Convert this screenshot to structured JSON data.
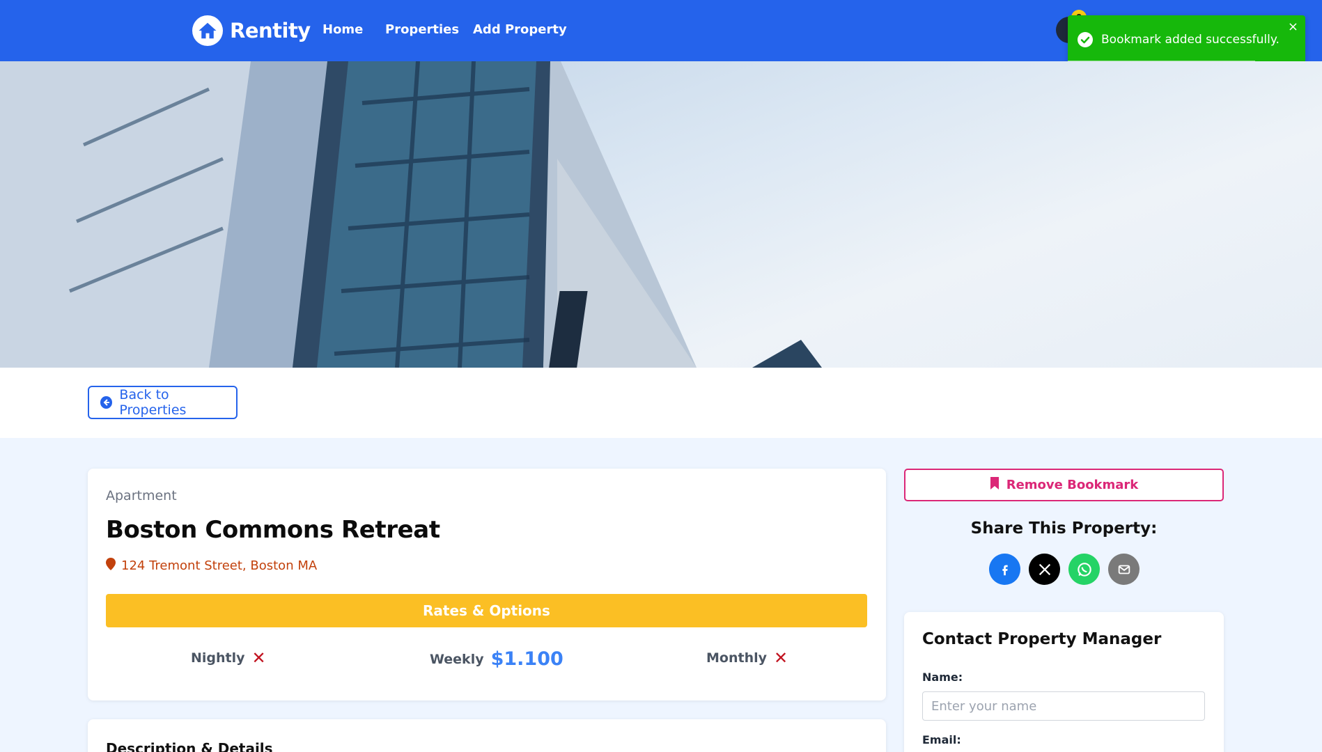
{
  "navbar": {
    "brand": "Rentity",
    "links": [
      "Home",
      "Properties",
      "Add Property"
    ],
    "notification_count": "0"
  },
  "toast": {
    "message": "Bookmark added successfully.",
    "close": "×",
    "progress": 0.79,
    "color": "#16b80b"
  },
  "back_button": {
    "label": "Back to Properties"
  },
  "property": {
    "type": "Apartment",
    "name": "Boston Commons Retreat",
    "address": "124 Tremont Street, Boston MA",
    "rates_title": "Rates & Options",
    "rates": {
      "nightly": {
        "label": "Nightly",
        "value": "✕"
      },
      "weekly": {
        "label": "Weekly",
        "value": "$1.100"
      },
      "monthly": {
        "label": "Monthly",
        "value": "✕"
      }
    },
    "description_title": "Description & Details"
  },
  "sidebar": {
    "remove_bookmark": "Remove Bookmark",
    "share_title": "Share This Property:",
    "share_icons": [
      "facebook-icon",
      "x-icon",
      "whatsapp-icon",
      "email-icon"
    ],
    "contact": {
      "title": "Contact Property Manager",
      "name_label": "Name:",
      "name_placeholder": "Enter your name",
      "email_label": "Email:"
    }
  },
  "colors": {
    "primary": "#2563eb",
    "accent_yellow": "#fbbf24",
    "bookmark_pink": "#db2777",
    "address_orange": "#c2410c",
    "rate_blue": "#3b82f6",
    "cross_red": "#c1121f"
  }
}
